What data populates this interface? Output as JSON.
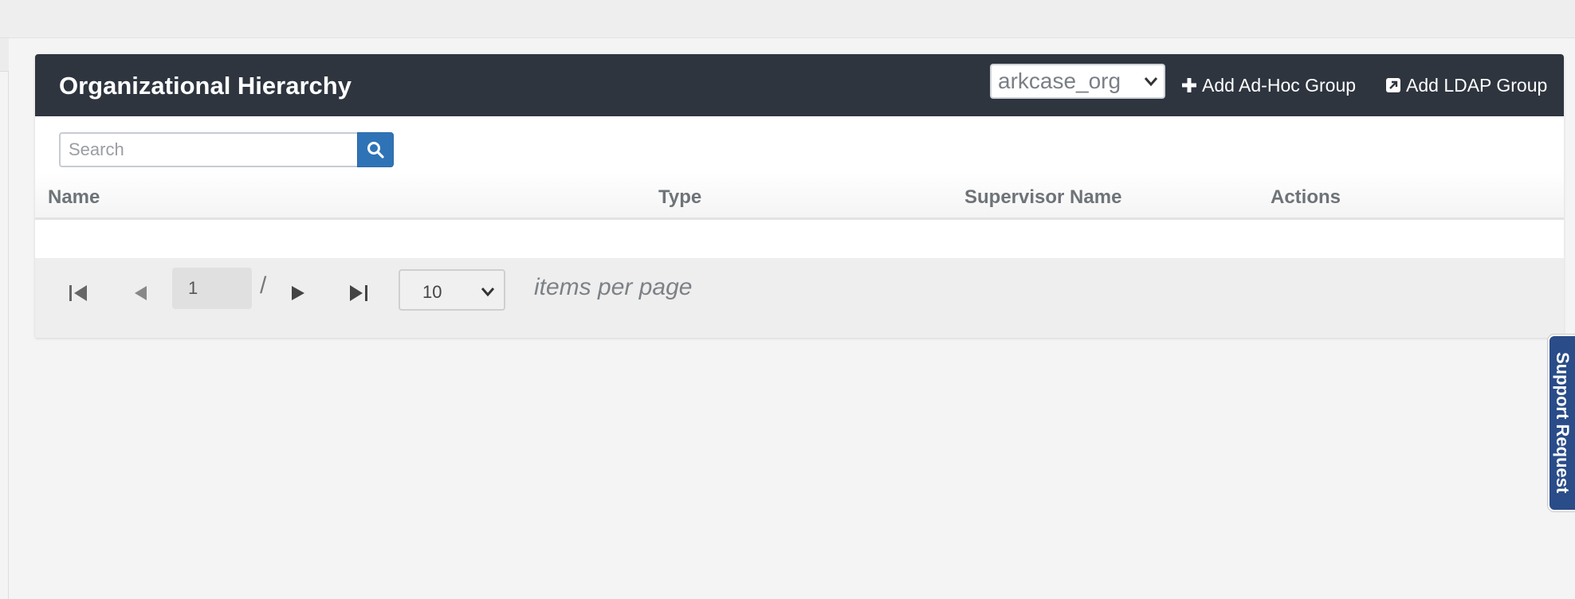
{
  "panel": {
    "title": "Organizational Hierarchy",
    "org_select": {
      "value": "arkcase_org"
    },
    "actions": [
      {
        "label": "Add Ad-Hoc Group",
        "icon": "plus-icon"
      },
      {
        "label": "Add LDAP Group",
        "icon": "external-link-icon"
      }
    ]
  },
  "search": {
    "placeholder": "Search",
    "value": "",
    "button_icon": "search-icon"
  },
  "table": {
    "columns": [
      "Name",
      "Type",
      "Supervisor Name",
      "Actions"
    ],
    "rows": []
  },
  "pager": {
    "current_page": "1",
    "separator": "/",
    "page_size": "10",
    "items_per_page_label": "items per page",
    "icons": [
      "first-page-icon",
      "prev-page-icon",
      "next-page-icon",
      "last-page-icon"
    ]
  },
  "support_tab": {
    "label": "Support Request"
  },
  "colors": {
    "header_bg": "#2e353f",
    "search_button": "#2f73b7",
    "support_tab": "#2a4c88"
  }
}
